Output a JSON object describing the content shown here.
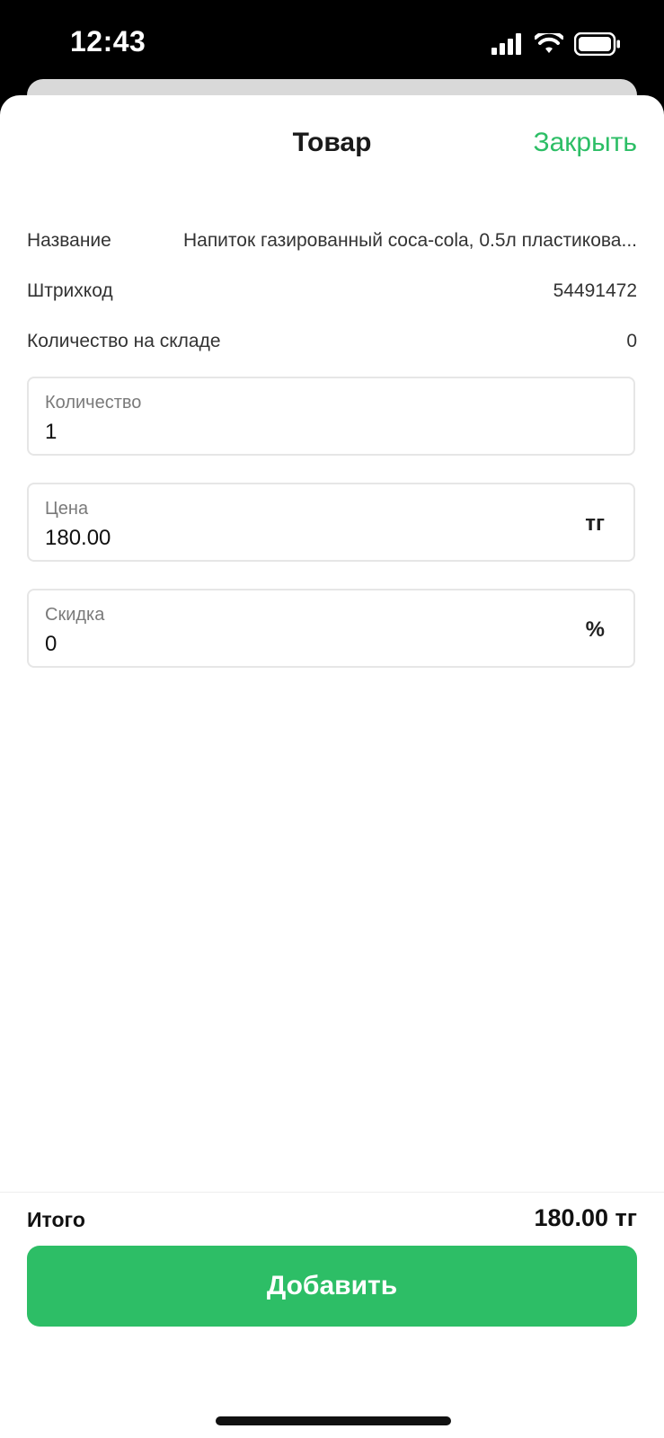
{
  "status_bar": {
    "time": "12:43",
    "icons": [
      "signal-icon",
      "wifi-icon",
      "battery-icon"
    ]
  },
  "header": {
    "title": "Товар",
    "close_label": "Закрыть"
  },
  "info": {
    "name_label": "Название",
    "name_value": "Напиток газированный coca-cola, 0.5л пластикова...",
    "barcode_label": "Штрихкод",
    "barcode_value": "54491472",
    "stock_label": "Количество на складе",
    "stock_value": "0"
  },
  "fields": {
    "quantity": {
      "label": "Количество",
      "value": "1"
    },
    "price": {
      "label": "Цена",
      "value": "180.00",
      "suffix": "тг"
    },
    "discount": {
      "label": "Скидка",
      "value": "0",
      "suffix": "%"
    }
  },
  "footer": {
    "total_label": "Итого",
    "total_value": "180.00 тг",
    "add_label": "Добавить"
  },
  "colors": {
    "accent": "#2dbe66",
    "background": "#ffffff",
    "status_bar": "#000000"
  }
}
